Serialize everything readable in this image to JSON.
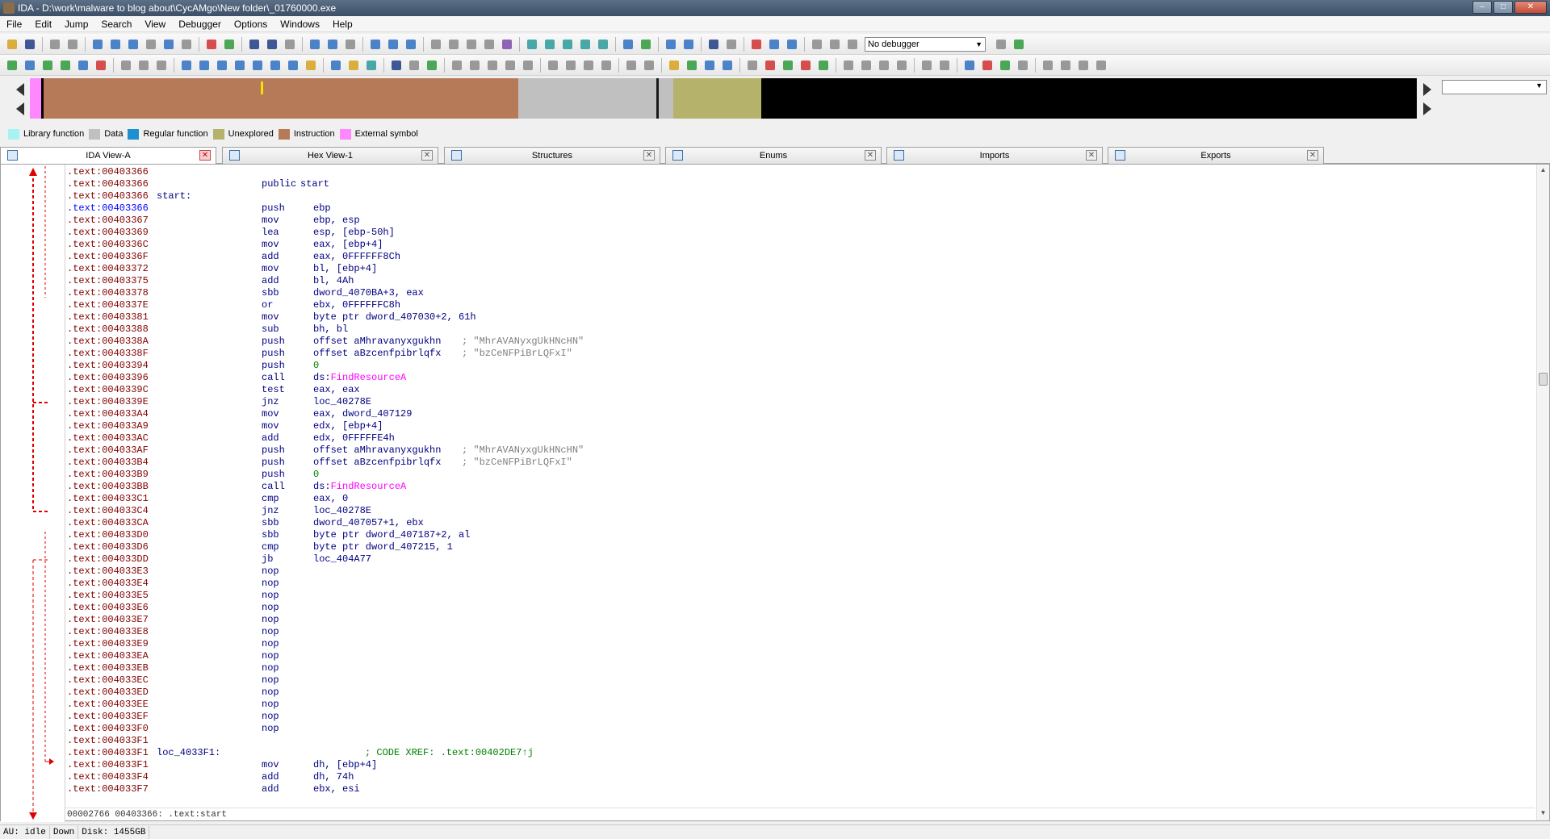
{
  "window": {
    "title": "IDA - D:\\work\\malware to blog about\\CycAMgo\\New folder\\_01760000.exe",
    "buttons": {
      "minimize": "–",
      "maximize": "□",
      "close": "✕"
    }
  },
  "menu": [
    "File",
    "Edit",
    "Jump",
    "Search",
    "View",
    "Debugger",
    "Options",
    "Windows",
    "Help"
  ],
  "toolbar": {
    "debugger_select": "No debugger"
  },
  "nav_band": {
    "colors": {
      "library": "#a7f3f3",
      "data": "#c0c0c0",
      "regular": "#1e90d0",
      "unexplored": "#b5b36b",
      "instruction": "#b77a58",
      "external": "#ff88ff",
      "black": "#000000"
    }
  },
  "legend": [
    {
      "label": "Library function",
      "color": "#a7f3f3"
    },
    {
      "label": "Data",
      "color": "#c0c0c0"
    },
    {
      "label": "Regular function",
      "color": "#1e90d0"
    },
    {
      "label": "Unexplored",
      "color": "#b5b36b"
    },
    {
      "label": "Instruction",
      "color": "#b77a58"
    },
    {
      "label": "External symbol",
      "color": "#ff88ff"
    }
  ],
  "tabs": [
    {
      "label": "IDA View-A",
      "active": true
    },
    {
      "label": "Hex View-1",
      "active": false
    },
    {
      "label": "Structures",
      "active": false
    },
    {
      "label": "Enums",
      "active": false
    },
    {
      "label": "Imports",
      "active": false
    },
    {
      "label": "Exports",
      "active": false
    }
  ],
  "listing": [
    {
      "addr": ".text:00403366",
      "label": "",
      "mnem": "",
      "ops": "",
      "dot": false
    },
    {
      "addr": ".text:00403366",
      "label": "",
      "mnem": "public",
      "ops": "start",
      "dot": false
    },
    {
      "addr": ".text:00403366",
      "label": "start:",
      "mnem": "",
      "ops": "",
      "dot": false
    },
    {
      "addr": ".text:00403366",
      "label": "",
      "mnem": "push",
      "ops": "ebp",
      "dot": true,
      "highlight": true
    },
    {
      "addr": ".text:00403367",
      "label": "",
      "mnem": "mov",
      "ops": "ebp, esp",
      "dot": true
    },
    {
      "addr": ".text:00403369",
      "label": "",
      "mnem": "lea",
      "ops": "esp, [ebp-50h]",
      "dot": true
    },
    {
      "addr": ".text:0040336C",
      "label": "",
      "mnem": "mov",
      "ops": "eax, [ebp+4]",
      "dot": true
    },
    {
      "addr": ".text:0040336F",
      "label": "",
      "mnem": "add",
      "ops": "eax, 0FFFFFF8Ch",
      "dot": true
    },
    {
      "addr": ".text:00403372",
      "label": "",
      "mnem": "mov",
      "ops": "bl, [ebp+4]",
      "dot": true
    },
    {
      "addr": ".text:00403375",
      "label": "",
      "mnem": "add",
      "ops": "bl, 4Ah",
      "dot": true
    },
    {
      "addr": ".text:00403378",
      "label": "",
      "mnem": "sbb",
      "ops": "dword_4070BA+3, eax",
      "dot": true
    },
    {
      "addr": ".text:0040337E",
      "label": "",
      "mnem": "or",
      "ops": "ebx, 0FFFFFFC8h",
      "dot": true
    },
    {
      "addr": ".text:00403381",
      "label": "",
      "mnem": "mov",
      "ops": "byte ptr dword_407030+2, 61h",
      "dot": true
    },
    {
      "addr": ".text:00403388",
      "label": "",
      "mnem": "sub",
      "ops": "bh, bl",
      "dot": true
    },
    {
      "addr": ".text:0040338A",
      "label": "",
      "mnem": "push",
      "ops": "offset aMhravanyxgukhn",
      "comment": "; \"MhrAVANyxgUkHNcHN\"",
      "dot": true
    },
    {
      "addr": ".text:0040338F",
      "label": "",
      "mnem": "push",
      "ops": "offset aBzcenfpibrlqfx",
      "comment": "; \"bzCeNFPiBrLQFxI\"",
      "dot": true
    },
    {
      "addr": ".text:00403394",
      "label": "",
      "mnem": "push",
      "ops": "0",
      "dot": true
    },
    {
      "addr": ".text:00403396",
      "label": "",
      "mnem": "call",
      "ops": "ds:FindResourceA",
      "dot": true
    },
    {
      "addr": ".text:0040339C",
      "label": "",
      "mnem": "test",
      "ops": "eax, eax",
      "dot": true
    },
    {
      "addr": ".text:0040339E",
      "label": "",
      "mnem": "jnz",
      "ops": "loc_40278E",
      "dot": true
    },
    {
      "addr": ".text:004033A4",
      "label": "",
      "mnem": "mov",
      "ops": "eax, dword_407129",
      "dot": true
    },
    {
      "addr": ".text:004033A9",
      "label": "",
      "mnem": "mov",
      "ops": "edx, [ebp+4]",
      "dot": true
    },
    {
      "addr": ".text:004033AC",
      "label": "",
      "mnem": "add",
      "ops": "edx, 0FFFFFE4h",
      "dot": true
    },
    {
      "addr": ".text:004033AF",
      "label": "",
      "mnem": "push",
      "ops": "offset aMhravanyxgukhn",
      "comment": "; \"MhrAVANyxgUkHNcHN\"",
      "dot": true
    },
    {
      "addr": ".text:004033B4",
      "label": "",
      "mnem": "push",
      "ops": "offset aBzcenfpibrlqfx",
      "comment": "; \"bzCeNFPiBrLQFxI\"",
      "dot": true
    },
    {
      "addr": ".text:004033B9",
      "label": "",
      "mnem": "push",
      "ops": "0",
      "dot": true
    },
    {
      "addr": ".text:004033BB",
      "label": "",
      "mnem": "call",
      "ops": "ds:FindResourceA",
      "dot": true
    },
    {
      "addr": ".text:004033C1",
      "label": "",
      "mnem": "cmp",
      "ops": "eax, 0",
      "dot": true
    },
    {
      "addr": ".text:004033C4",
      "label": "",
      "mnem": "jnz",
      "ops": "loc_40278E",
      "dot": true
    },
    {
      "addr": ".text:004033CA",
      "label": "",
      "mnem": "sbb",
      "ops": "dword_407057+1, ebx",
      "dot": true
    },
    {
      "addr": ".text:004033D0",
      "label": "",
      "mnem": "sbb",
      "ops": "byte ptr dword_407187+2, al",
      "dot": true
    },
    {
      "addr": ".text:004033D6",
      "label": "",
      "mnem": "cmp",
      "ops": "byte ptr dword_407215, 1",
      "dot": true
    },
    {
      "addr": ".text:004033DD",
      "label": "",
      "mnem": "jb",
      "ops": "loc_404A77",
      "dot": true
    },
    {
      "addr": ".text:004033E3",
      "label": "",
      "mnem": "nop",
      "ops": "",
      "dot": true
    },
    {
      "addr": ".text:004033E4",
      "label": "",
      "mnem": "nop",
      "ops": "",
      "dot": true
    },
    {
      "addr": ".text:004033E5",
      "label": "",
      "mnem": "nop",
      "ops": "",
      "dot": true
    },
    {
      "addr": ".text:004033E6",
      "label": "",
      "mnem": "nop",
      "ops": "",
      "dot": true
    },
    {
      "addr": ".text:004033E7",
      "label": "",
      "mnem": "nop",
      "ops": "",
      "dot": true
    },
    {
      "addr": ".text:004033E8",
      "label": "",
      "mnem": "nop",
      "ops": "",
      "dot": true
    },
    {
      "addr": ".text:004033E9",
      "label": "",
      "mnem": "nop",
      "ops": "",
      "dot": true
    },
    {
      "addr": ".text:004033EA",
      "label": "",
      "mnem": "nop",
      "ops": "",
      "dot": true
    },
    {
      "addr": ".text:004033EB",
      "label": "",
      "mnem": "nop",
      "ops": "",
      "dot": true
    },
    {
      "addr": ".text:004033EC",
      "label": "",
      "mnem": "nop",
      "ops": "",
      "dot": true
    },
    {
      "addr": ".text:004033ED",
      "label": "",
      "mnem": "nop",
      "ops": "",
      "dot": true
    },
    {
      "addr": ".text:004033EE",
      "label": "",
      "mnem": "nop",
      "ops": "",
      "dot": true
    },
    {
      "addr": ".text:004033EF",
      "label": "",
      "mnem": "nop",
      "ops": "",
      "dot": true
    },
    {
      "addr": ".text:004033F0",
      "label": "",
      "mnem": "nop",
      "ops": "",
      "dot": true
    },
    {
      "addr": ".text:004033F1",
      "label": "",
      "mnem": "",
      "ops": "",
      "dot": false
    },
    {
      "addr": ".text:004033F1",
      "label": "loc_4033F1:",
      "mnem": "",
      "ops": "",
      "xref": "; CODE XREF: .text:00402DE7↑j",
      "dot": false
    },
    {
      "addr": ".text:004033F1",
      "label": "",
      "mnem": "mov",
      "ops": "dh, [ebp+4]",
      "dot": true
    },
    {
      "addr": ".text:004033F4",
      "label": "",
      "mnem": "add",
      "ops": "dh, 74h",
      "dot": true
    },
    {
      "addr": ".text:004033F7",
      "label": "",
      "mnem": "add",
      "ops": "ebx, esi",
      "dot": true
    }
  ],
  "status_line": "00002766 00403366: .text:start",
  "statusbar": {
    "au": "AU:  idle",
    "dir": "Down",
    "disk": "Disk: 1455GB"
  }
}
